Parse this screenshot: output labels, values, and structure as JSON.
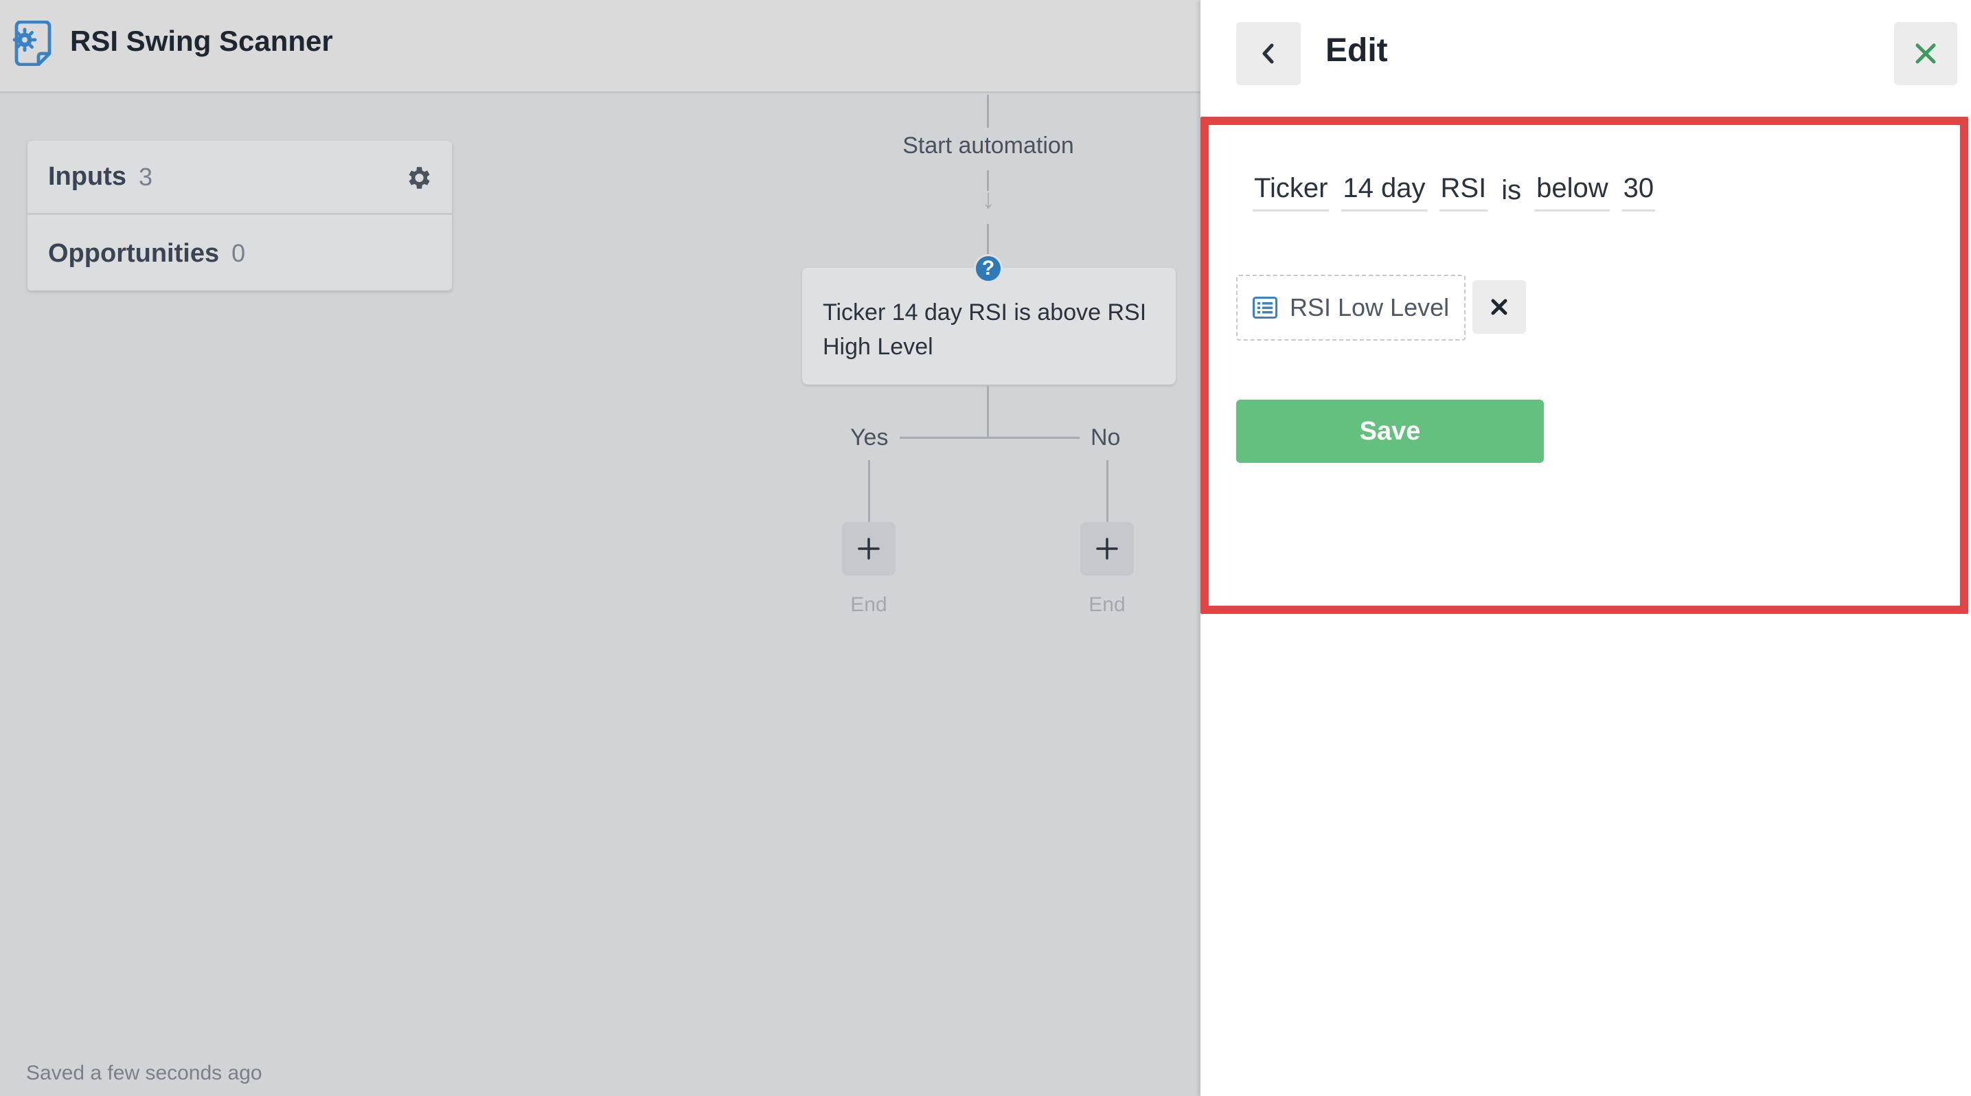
{
  "app": {
    "title": "RSI Swing Scanner",
    "logo_icon": "scanner-gear-document-icon"
  },
  "sidebar": {
    "items": [
      {
        "label": "Inputs",
        "count": "3"
      },
      {
        "label": "Opportunities",
        "count": "0"
      }
    ],
    "settings_icon": "gear-icon"
  },
  "flow": {
    "start_label": "Start automation",
    "arrow_icon": "arrow-down-icon",
    "help_icon": "?",
    "condition_text": "Ticker 14 day RSI is above RSI High Level",
    "branches": [
      {
        "label": "Yes",
        "end_label": "End"
      },
      {
        "label": "No",
        "end_label": "End"
      }
    ],
    "add_icon": "plus-icon"
  },
  "status": {
    "saved_text": "Saved a few seconds ago"
  },
  "edit_panel": {
    "title": "Edit",
    "back_icon": "chevron-left-icon",
    "close_icon": "close-icon",
    "condition_tokens": [
      {
        "text": "Ticker",
        "editable": true
      },
      {
        "text": "14 day",
        "editable": true
      },
      {
        "text": "RSI",
        "editable": true
      },
      {
        "text": "is",
        "editable": false
      },
      {
        "text": "below",
        "editable": true
      },
      {
        "text": "30",
        "editable": true
      }
    ],
    "input_chip": {
      "label": "RSI Low Level",
      "icon": "list-icon"
    },
    "remove_icon": "remove-icon",
    "save_label": "Save"
  },
  "colors": {
    "accent_green": "#63c07f",
    "close_green": "#3e9b5e",
    "highlight_red": "#e04444",
    "help_blue": "#2e7ab6",
    "logo_blue": "#3b82c4"
  }
}
